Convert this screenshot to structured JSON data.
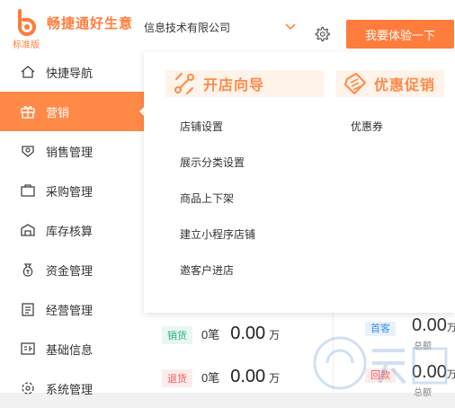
{
  "header": {
    "brand": "畅捷通好生意",
    "edition": "标准版",
    "company": "信息技术有限公司",
    "trial_button": "我要体验一下"
  },
  "sidebar": {
    "items": [
      {
        "label": "快捷导航",
        "icon": "home-icon"
      },
      {
        "label": "营销",
        "icon": "gift-icon",
        "active": true
      },
      {
        "label": "销售管理",
        "icon": "sales-icon"
      },
      {
        "label": "采购管理",
        "icon": "briefcase-icon"
      },
      {
        "label": "库存核算",
        "icon": "warehouse-icon"
      },
      {
        "label": "资金管理",
        "icon": "money-bag-icon"
      },
      {
        "label": "经营管理",
        "icon": "clipboard-icon"
      },
      {
        "label": "基础信息",
        "icon": "id-card-icon"
      },
      {
        "label": "系统管理",
        "icon": "settings-icon"
      }
    ]
  },
  "flyout": {
    "store_guide": {
      "title": "开店向导",
      "links": [
        "店铺设置",
        "展示分类设置",
        "商品上下架",
        "建立小程序店铺",
        "邀客户进店"
      ]
    },
    "promotion": {
      "title": "优惠促销",
      "links": [
        "优惠券"
      ]
    }
  },
  "dashboard": {
    "rows": [
      {
        "tag": "销货",
        "count": "0笔",
        "amount": "0.00",
        "unit": "万"
      },
      {
        "tag": "退货",
        "count": "0笔",
        "amount": "0.00",
        "unit": "万"
      }
    ],
    "right": [
      {
        "tag": "首客",
        "amount": "0.00",
        "unit": "万",
        "label": "总额"
      },
      {
        "tag": "回款",
        "amount": "0.00",
        "unit": "万",
        "label": "总额"
      }
    ]
  },
  "colors": {
    "accent": "#ff8a48",
    "button": "#ff7d3c",
    "section_bg": "#fff3ea"
  }
}
